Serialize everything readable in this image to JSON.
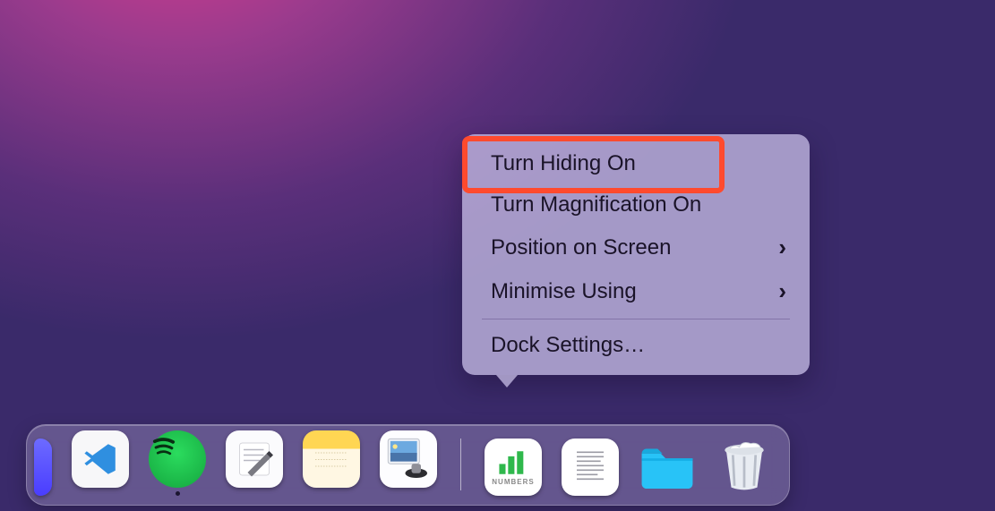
{
  "context_menu": {
    "items": [
      {
        "label": "Turn Hiding On",
        "submenu": false
      },
      {
        "label": "Turn Magnification On",
        "submenu": false
      },
      {
        "label": "Position on Screen",
        "submenu": true
      },
      {
        "label": "Minimise Using",
        "submenu": true
      }
    ],
    "settings_label": "Dock Settings…",
    "highlighted_index": 0,
    "highlight_color": "#ff4a2e"
  },
  "dock": {
    "apps": [
      {
        "name": "partial-app",
        "running": false
      },
      {
        "name": "vscode",
        "running": false
      },
      {
        "name": "spotify",
        "running": true
      },
      {
        "name": "textedit",
        "running": false
      },
      {
        "name": "notes",
        "running": false
      },
      {
        "name": "preview",
        "running": false
      }
    ],
    "right_items": [
      {
        "name": "numbers-document",
        "badge": "NUMBERS"
      },
      {
        "name": "text-document"
      },
      {
        "name": "downloads-folder"
      },
      {
        "name": "trash"
      }
    ]
  }
}
